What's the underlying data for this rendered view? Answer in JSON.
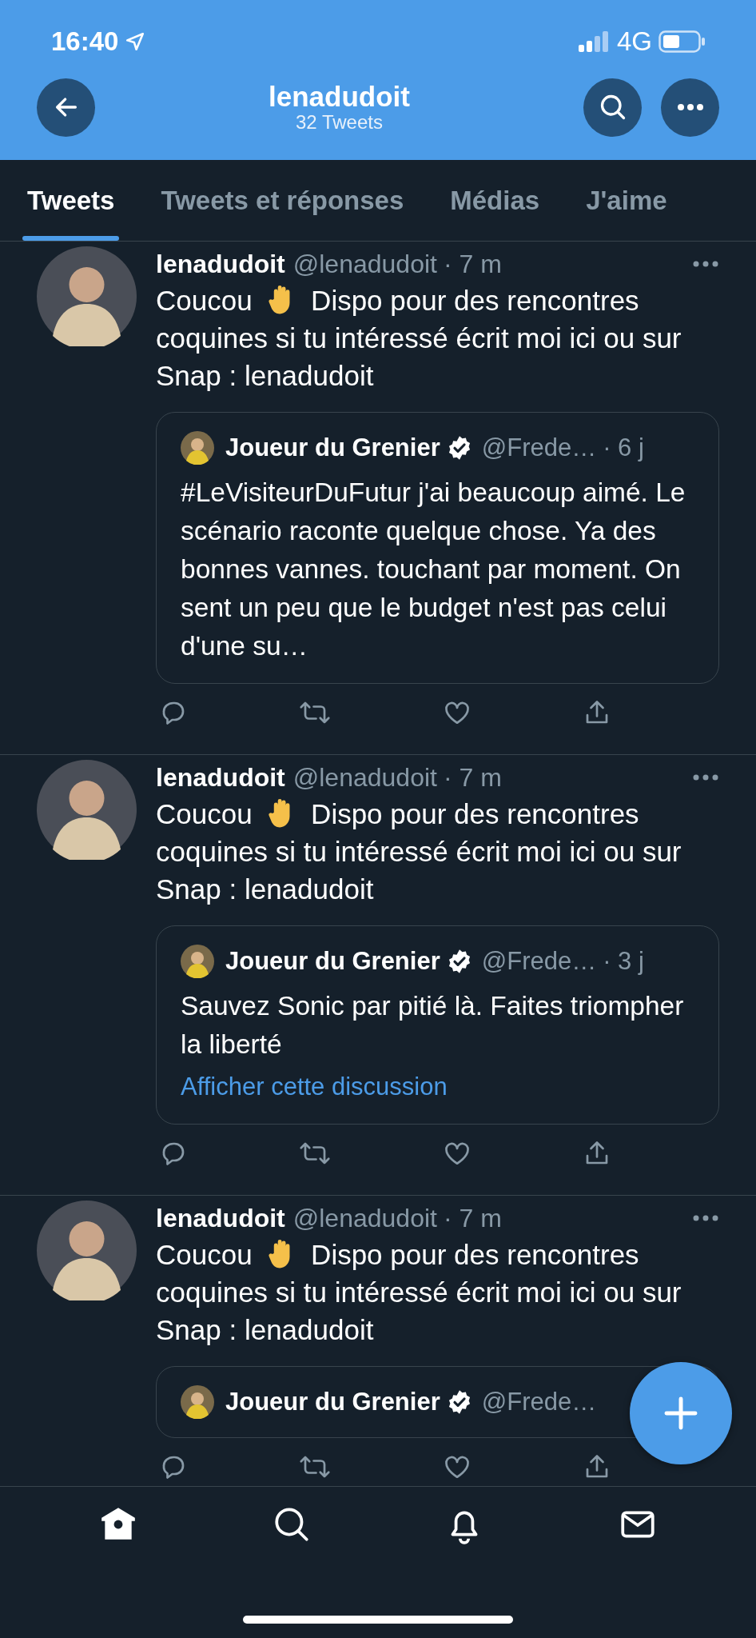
{
  "status_bar": {
    "time": "16:40",
    "network": "4G"
  },
  "header": {
    "title": "lenadudoit",
    "subtitle": "32 Tweets"
  },
  "tabs": [
    {
      "label": "Tweets",
      "selected": true
    },
    {
      "label": "Tweets et réponses",
      "selected": false
    },
    {
      "label": "Médias",
      "selected": false
    },
    {
      "label": "J'aime",
      "selected": false
    }
  ],
  "tweets": [
    {
      "name": "lenadudoit",
      "handle": "@lenadudoit",
      "time": "· 7 m",
      "greeting": "Coucou",
      "text": "Dispo pour des rencontres coquines si tu intéressé écrit moi ici ou sur Snap : lenadudoit",
      "quote": {
        "name": "Joueur du Grenier",
        "verified": true,
        "handle": "@Frede…",
        "time": "· 6 j",
        "text": "#LeVisiteurDuFutur j'ai beaucoup aimé. Le scénario raconte quelque chose. Ya des bonnes vannes. touchant par moment. On sent un peu que le budget n'est pas celui d'une su…"
      }
    },
    {
      "name": "lenadudoit",
      "handle": "@lenadudoit",
      "time": "· 7 m",
      "greeting": "Coucou",
      "text": "Dispo pour des rencontres coquines si tu intéressé écrit moi ici ou sur Snap : lenadudoit",
      "quote": {
        "name": "Joueur du Grenier",
        "verified": true,
        "handle": "@Frede…",
        "time": "· 3 j",
        "text": "Sauvez Sonic par pitié là. Faites triompher la liberté",
        "link": "Afficher cette discussion"
      }
    },
    {
      "name": "lenadudoit",
      "handle": "@lenadudoit",
      "time": "· 7 m",
      "greeting": "Coucou",
      "text": "Dispo pour des rencontres coquines si tu intéressé écrit moi ici ou sur Snap : lenadudoit",
      "quote": {
        "name": "Joueur du Grenier",
        "verified": true,
        "handle": "@Frede…"
      }
    }
  ],
  "bottom_nav": [
    {
      "kind": "home",
      "selected": true
    },
    {
      "kind": "search",
      "selected": false
    },
    {
      "kind": "notifications",
      "selected": false
    },
    {
      "kind": "messages",
      "selected": false
    }
  ]
}
